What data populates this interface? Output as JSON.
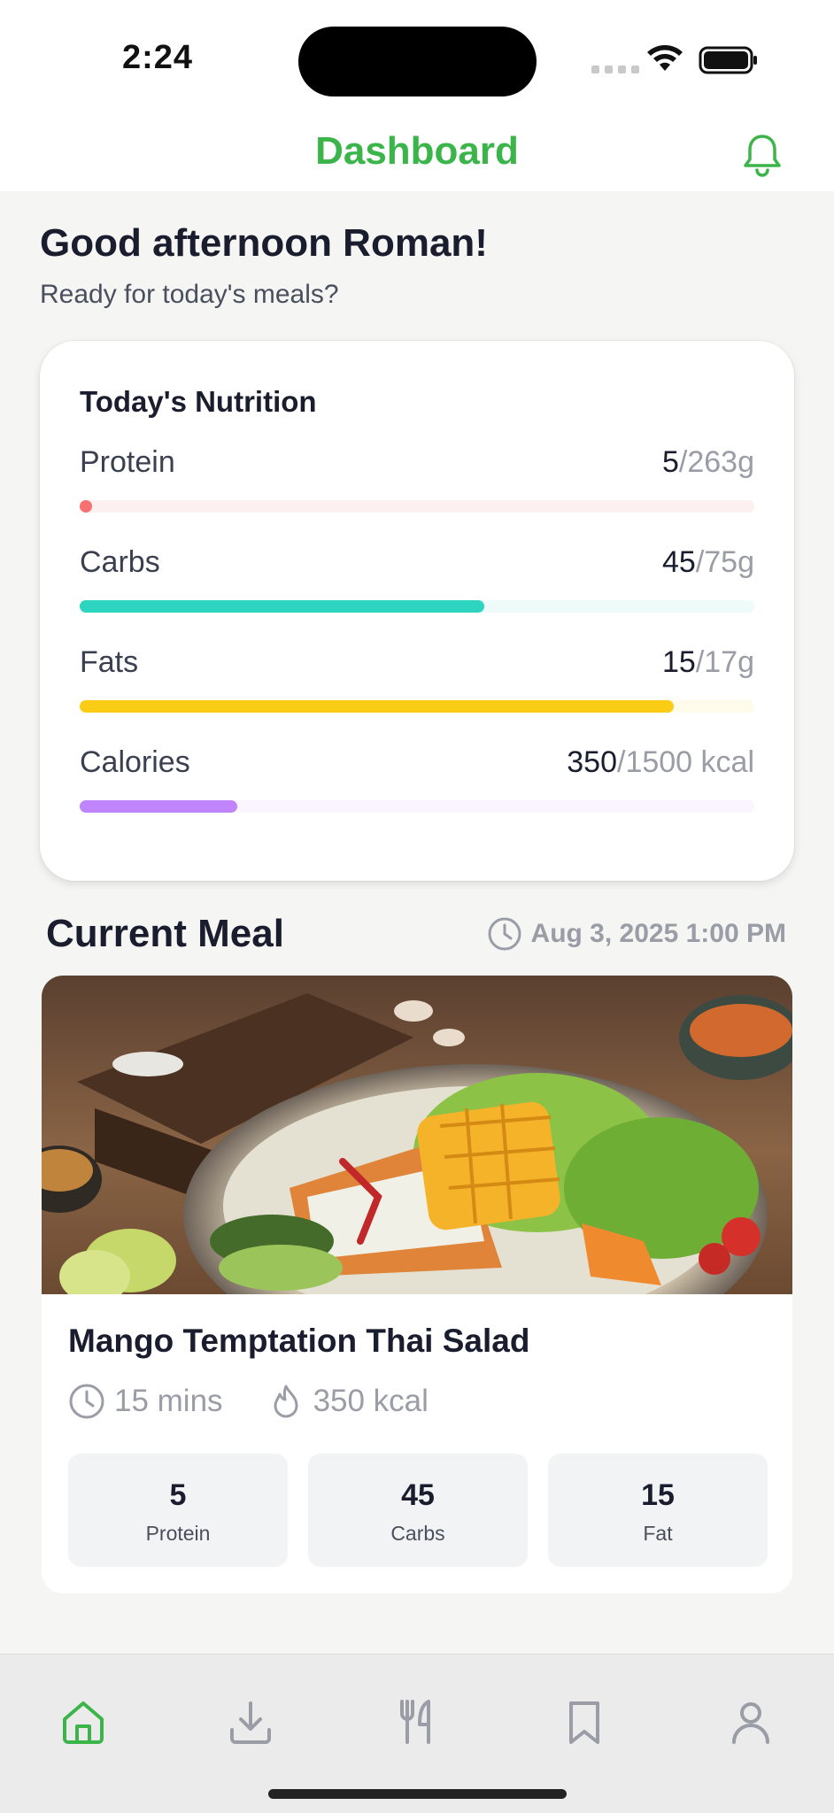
{
  "status_bar": {
    "time": "2:24"
  },
  "header": {
    "title": "Dashboard"
  },
  "greeting": {
    "title": "Good afternoon Roman!",
    "subtitle": "Ready for today's meals?"
  },
  "nutrition": {
    "title": "Today's Nutrition",
    "items": [
      {
        "label": "Protein",
        "current": "5",
        "target": "263g",
        "fraction": 0.019,
        "bar_color": "#f87171",
        "track_color": "#fdf0f0"
      },
      {
        "label": "Carbs",
        "current": "45",
        "target": "75g",
        "fraction": 0.6,
        "bar_color": "#2dd4bf",
        "track_color": "#effbf8"
      },
      {
        "label": "Fats",
        "current": "15",
        "target": "17g",
        "fraction": 0.88,
        "bar_color": "#facc15",
        "track_color": "#fefbea"
      },
      {
        "label": "Calories",
        "current": "350",
        "target": "1500 kcal",
        "fraction": 0.233,
        "bar_color": "#c084fc",
        "track_color": "#faf5fe"
      }
    ]
  },
  "current_meal": {
    "heading": "Current Meal",
    "datetime": "Aug 3, 2025 1:00 PM",
    "name": "Mango Temptation Thai Salad",
    "time": "15 mins",
    "calories": "350 kcal",
    "macros": [
      {
        "value": "5",
        "label": "Protein"
      },
      {
        "value": "45",
        "label": "Carbs"
      },
      {
        "value": "15",
        "label": "Fat"
      }
    ]
  },
  "tab_bar": {
    "active": "home",
    "accent": "#3bb54a",
    "inactive": "#9a9ca6",
    "items": [
      "home-icon",
      "download-icon",
      "utensils-icon",
      "bookmark-icon",
      "profile-icon"
    ]
  }
}
